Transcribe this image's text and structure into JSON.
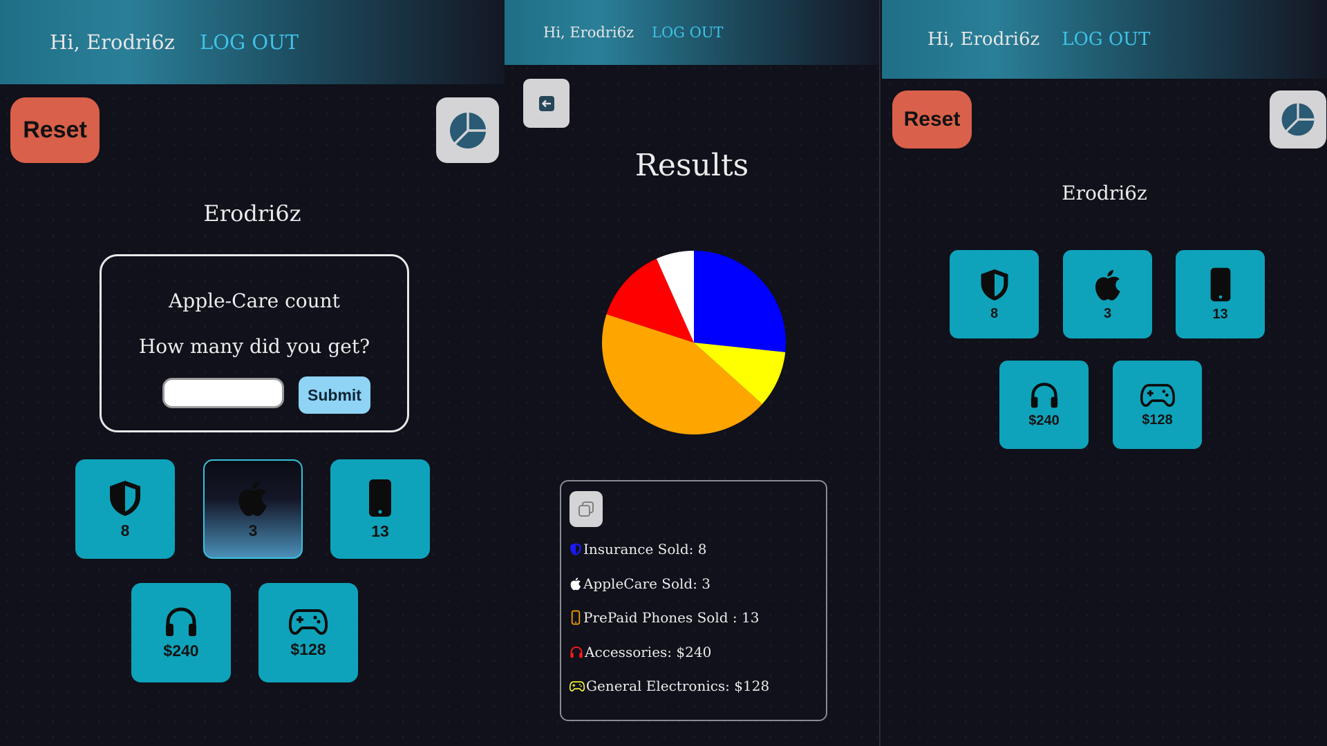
{
  "header": {
    "greeting": "Hi, Erodri6z",
    "logout_label": "LOG OUT"
  },
  "reset_label": "Reset",
  "username": "Erodri6z",
  "count_dialog": {
    "title": "Apple-Care count",
    "question": "How many did you get?",
    "input_value": "",
    "submit_label": "Submit"
  },
  "tiles": [
    {
      "icon": "shield-icon",
      "label": "8"
    },
    {
      "icon": "apple-icon",
      "label": "3"
    },
    {
      "icon": "phone-icon",
      "label": "13"
    },
    {
      "icon": "headphones-icon",
      "label": "$240"
    },
    {
      "icon": "gamepad-icon",
      "label": "$128"
    }
  ],
  "results": {
    "title": "Results",
    "summary": [
      {
        "icon": "shield-icon",
        "text": "Insurance Sold: 8",
        "color": "#1a1aff"
      },
      {
        "icon": "apple-icon",
        "text": "AppleCare Sold: 3",
        "color": "#ffffff"
      },
      {
        "icon": "phone-icon",
        "text": "PrePaid Phones Sold : 13",
        "color": "#ffa500"
      },
      {
        "icon": "headphones-icon",
        "text": "Accessories: $240",
        "color": "#ff0000"
      },
      {
        "icon": "gamepad-icon",
        "text": "General Electronics: $128",
        "color": "#ffff00"
      }
    ]
  },
  "chart_data": {
    "type": "pie",
    "slices": [
      {
        "value": 8,
        "color": "#0000ff"
      },
      {
        "value": 3,
        "color": "#ffff00"
      },
      {
        "value": 13,
        "color": "#ffa500"
      },
      {
        "value": 4,
        "color": "#ff0000"
      },
      {
        "value": 2,
        "color": "#ffffff"
      }
    ]
  },
  "colors": {
    "accent": "#0ea3bb",
    "reset": "#d9604a",
    "link": "#3fc3e8",
    "submit": "#8fd3f5"
  }
}
